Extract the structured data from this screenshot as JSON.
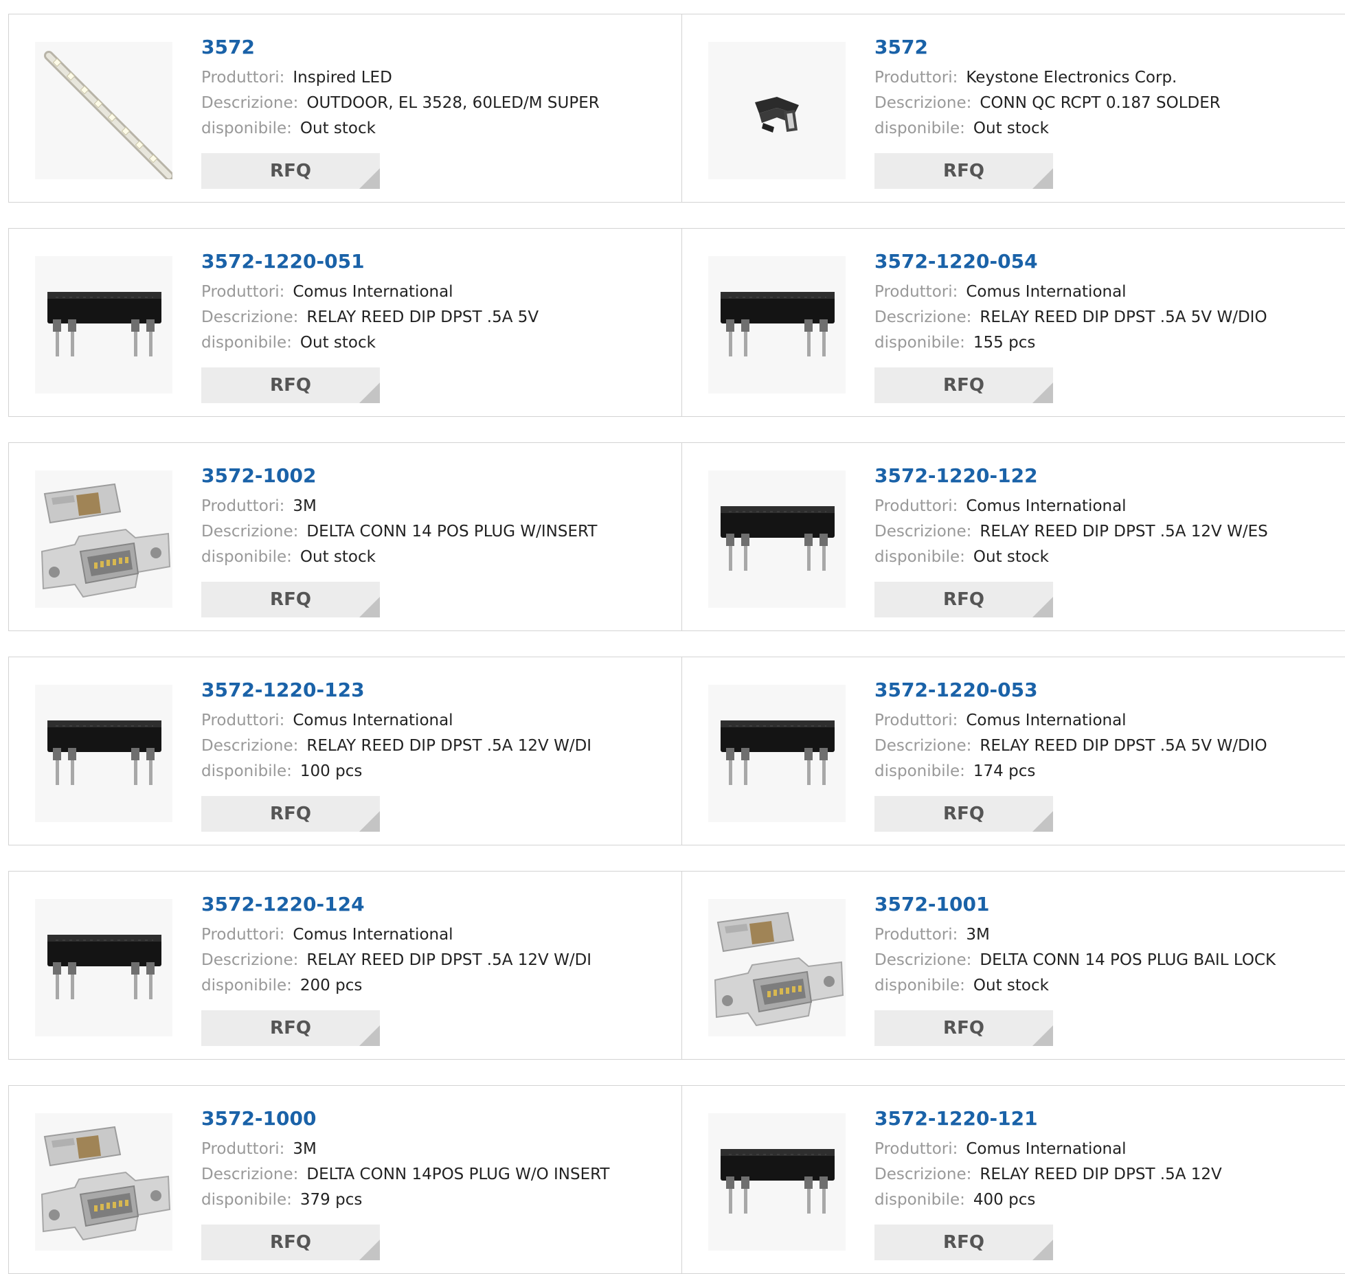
{
  "labels": {
    "manufacturer": "Produttori:",
    "description": "Descrizione:",
    "availability": "disponibile:",
    "rfq": "RFQ"
  },
  "products": [
    {
      "part": "3572",
      "manufacturer": "Inspired LED",
      "description": "OUTDOOR, EL 3528, 60LED/M SUPER",
      "availability": "Out stock",
      "image": "led-strip-icon"
    },
    {
      "part": "3572",
      "manufacturer": "Keystone Electronics Corp.",
      "description": "CONN QC RCPT 0.187 SOLDER",
      "availability": "Out stock",
      "image": "quick-connect-icon"
    },
    {
      "part": "3572-1220-051",
      "manufacturer": "Comus International",
      "description": "RELAY REED DIP DPST .5A 5V",
      "availability": "Out stock",
      "image": "relay-icon"
    },
    {
      "part": "3572-1220-054",
      "manufacturer": "Comus International",
      "description": "RELAY REED DIP DPST .5A 5V W/DIO",
      "availability": "155 pcs",
      "image": "relay-icon"
    },
    {
      "part": "3572-1002",
      "manufacturer": "3M",
      "description": "DELTA CONN 14 POS PLUG W/INSERT",
      "availability": "Out stock",
      "image": "connector-icon"
    },
    {
      "part": "3572-1220-122",
      "manufacturer": "Comus International",
      "description": "RELAY REED DIP DPST .5A 12V W/ES",
      "availability": "Out stock",
      "image": "relay-icon"
    },
    {
      "part": "3572-1220-123",
      "manufacturer": "Comus International",
      "description": "RELAY REED DIP DPST .5A 12V W/DI",
      "availability": "100 pcs",
      "image": "relay-icon"
    },
    {
      "part": "3572-1220-053",
      "manufacturer": "Comus International",
      "description": "RELAY REED DIP DPST .5A 5V W/DIO",
      "availability": "174 pcs",
      "image": "relay-icon"
    },
    {
      "part": "3572-1220-124",
      "manufacturer": "Comus International",
      "description": "RELAY REED DIP DPST .5A 12V W/DI",
      "availability": "200 pcs",
      "image": "relay-icon"
    },
    {
      "part": "3572-1001",
      "manufacturer": "3M",
      "description": "DELTA CONN 14 POS PLUG BAIL LOCK",
      "availability": "Out stock",
      "image": "connector-icon"
    },
    {
      "part": "3572-1000",
      "manufacturer": "3M",
      "description": "DELTA CONN 14POS PLUG W/O INSERT",
      "availability": "379 pcs",
      "image": "connector-icon"
    },
    {
      "part": "3572-1220-121",
      "manufacturer": "Comus International",
      "description": "RELAY REED DIP DPST .5A 12V",
      "availability": "400 pcs",
      "image": "relay-icon"
    }
  ],
  "colors": {
    "link": "#1a62a8",
    "label": "#999999",
    "button_bg": "#ececec"
  }
}
